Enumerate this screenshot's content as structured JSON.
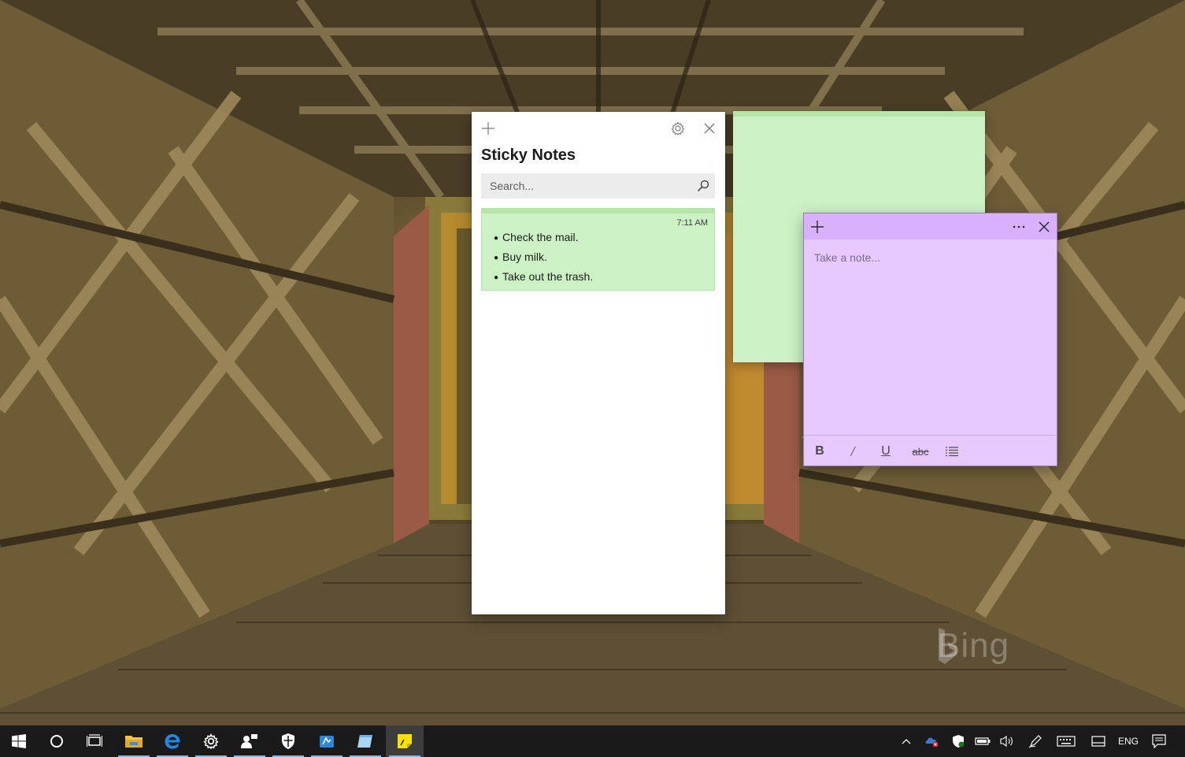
{
  "list_window": {
    "title": "Sticky Notes",
    "search_placeholder": "Search...",
    "notes": [
      {
        "time": "7:11 AM",
        "items": [
          "Check the mail.",
          "Buy milk.",
          "Take out the trash."
        ],
        "color": "#cbf1c4"
      }
    ]
  },
  "purple_note": {
    "placeholder": "Take a note...",
    "color": "#e7c8ff",
    "header_color": "#d9b0fc",
    "toolbar": {
      "bold": "B",
      "italic": "/",
      "underline": "U",
      "strikethrough": "abc"
    }
  },
  "green_note": {
    "color": "#cbf1c4"
  },
  "wallpaper": {
    "watermark": "Bing"
  },
  "taskbar": {
    "apps": [
      "start-icon",
      "cortana-icon",
      "task-view-icon",
      "file-explorer-icon",
      "edge-icon",
      "settings-icon",
      "people-icon",
      "defender-icon",
      "azure-icon",
      "notepad-icon",
      "sticky-notes-icon"
    ],
    "language": "ENG"
  }
}
